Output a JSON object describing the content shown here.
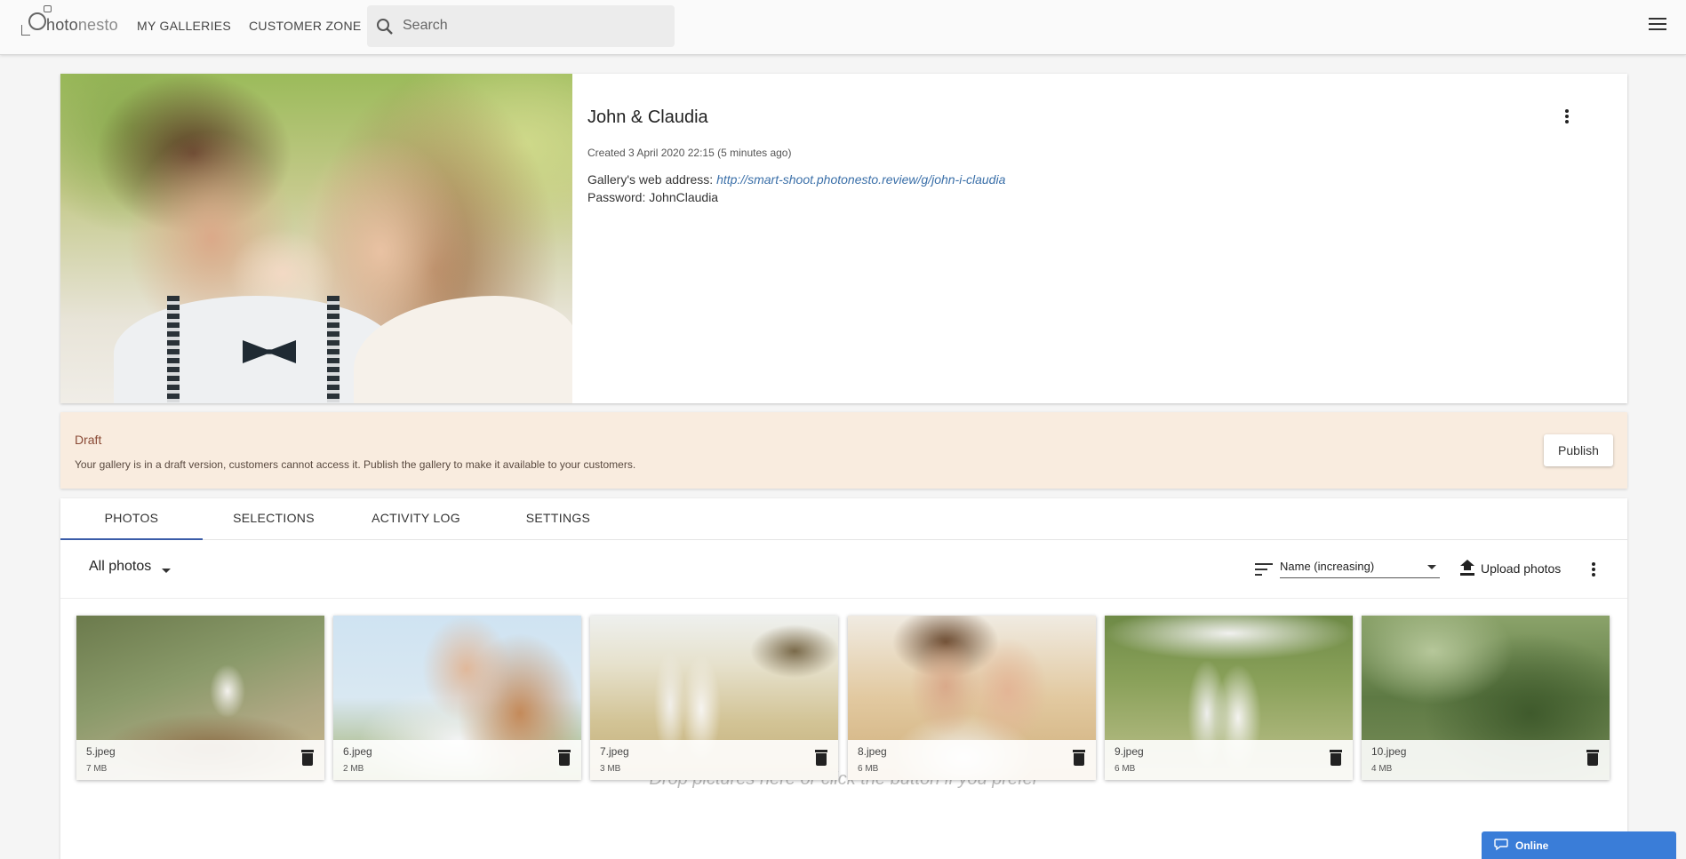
{
  "header": {
    "logo_text_main": "hoto",
    "logo_text_accent": "nesto",
    "nav": [
      {
        "label": "MY GALLERIES"
      },
      {
        "label": "CUSTOMER ZONE"
      }
    ],
    "search_placeholder": "Search"
  },
  "gallery": {
    "title": "John & Claudia",
    "created": "Created 3 April 2020 22:15 (5 minutes ago)",
    "web_address_label": "Gallery's web address:",
    "web_address_url": "http://smart-shoot.photonesto.review/g/john-i-claudia",
    "password_label": "Password:",
    "password_value": "JohnClaudia"
  },
  "draft": {
    "title": "Draft",
    "message": "Your gallery is in a draft version, customers cannot access it. Publish the gallery to make it available to your customers.",
    "publish_label": "Publish"
  },
  "tabs": [
    {
      "label": "PHOTOS",
      "active": true
    },
    {
      "label": "SELECTIONS",
      "active": false
    },
    {
      "label": "ACTIVITY LOG",
      "active": false
    },
    {
      "label": "SETTINGS",
      "active": false
    }
  ],
  "toolbar": {
    "filter_label": "All photos",
    "sort_value": "Name (increasing)",
    "upload_label": "Upload photos"
  },
  "drop_hint": "Drop pictures here or click the button if you prefer",
  "photos": [
    {
      "name": "5.jpeg",
      "size": "7 MB"
    },
    {
      "name": "6.jpeg",
      "size": "2 MB"
    },
    {
      "name": "7.jpeg",
      "size": "3 MB"
    },
    {
      "name": "8.jpeg",
      "size": "6 MB"
    },
    {
      "name": "9.jpeg",
      "size": "6 MB"
    },
    {
      "name": "10.jpeg",
      "size": "4 MB"
    }
  ],
  "chat": {
    "status_label": "Online"
  },
  "colors": {
    "accent": "#3a5ca8",
    "link": "#3a6fa8",
    "draft_bg": "#f9ecdf",
    "chat": "#3a7dd8"
  }
}
